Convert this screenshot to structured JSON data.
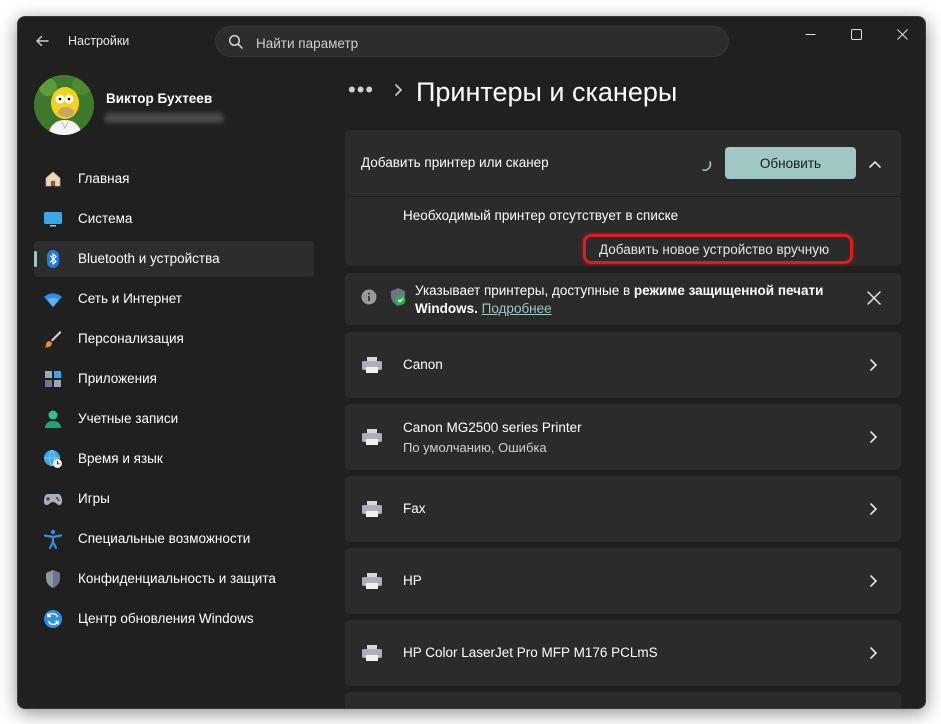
{
  "window": {
    "app_title": "Настройки",
    "controls": {
      "minimize": "—",
      "maximize": "☐",
      "close": "✕"
    }
  },
  "search": {
    "placeholder": "Найти параметр",
    "value": ""
  },
  "user": {
    "name": "Виктор Бухтеев"
  },
  "sidebar": {
    "items": [
      {
        "label": "Главная",
        "icon": "home-icon",
        "active": false
      },
      {
        "label": "Система",
        "icon": "system-icon",
        "active": false
      },
      {
        "label": "Bluetooth и устройства",
        "icon": "bluetooth-icon",
        "active": true
      },
      {
        "label": "Сеть и Интернет",
        "icon": "wifi-icon",
        "active": false
      },
      {
        "label": "Персонализация",
        "icon": "brush-icon",
        "active": false
      },
      {
        "label": "Приложения",
        "icon": "apps-icon",
        "active": false
      },
      {
        "label": "Учетные записи",
        "icon": "account-icon",
        "active": false
      },
      {
        "label": "Время и язык",
        "icon": "globe-clock-icon",
        "active": false
      },
      {
        "label": "Игры",
        "icon": "gamepad-icon",
        "active": false
      },
      {
        "label": "Специальные возможности",
        "icon": "accessibility-icon",
        "active": false
      },
      {
        "label": "Конфиденциальность и защита",
        "icon": "shield-icon",
        "active": false
      },
      {
        "label": "Центр обновления Windows",
        "icon": "update-icon",
        "active": false
      }
    ]
  },
  "breadcrumb": {
    "more": "•••",
    "title": "Принтеры и сканеры"
  },
  "add_device": {
    "label": "Добавить принтер или сканер",
    "refresh_button": "Обновить",
    "missing_text": "Необходимый принтер отсутствует в списке",
    "manual_link": "Добавить новое устройство вручную"
  },
  "info_bar": {
    "text_plain": "Указывает принтеры, доступные в ",
    "text_bold": "режиме защищенной печати Windows.",
    "link": "Подробнее"
  },
  "printers": [
    {
      "name": "Canon",
      "status": ""
    },
    {
      "name": "Canon MG2500 series Printer",
      "status": "По умолчанию, Ошибка"
    },
    {
      "name": "Fax",
      "status": ""
    },
    {
      "name": "HP",
      "status": ""
    },
    {
      "name": "HP Color LaserJet Pro MFP M176 PCLmS",
      "status": ""
    }
  ],
  "colors": {
    "accent": "#9fc7c4",
    "highlight": "#e01b1b",
    "background": "#202020",
    "card": "#2b2b2b"
  }
}
